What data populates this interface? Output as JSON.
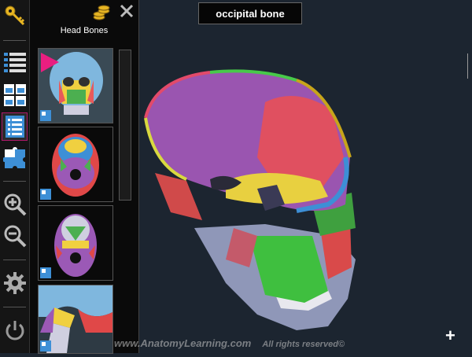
{
  "panel": {
    "title": "Head Bones"
  },
  "viewer": {
    "selected_label": "occipital bone"
  },
  "watermark": {
    "site": "www.AnatomyLearning.com",
    "rights": "All rights reserved©"
  },
  "toolbar": {
    "icons": [
      "key-icon",
      "list-view-icon",
      "grid-view-icon",
      "notes-icon",
      "puzzle-icon",
      "zoom-in-icon",
      "zoom-out-icon",
      "settings-icon",
      "power-icon"
    ]
  },
  "thumbnails": [
    "skull-front-view",
    "skull-top-view",
    "skull-bottom-view",
    "skull-side-view"
  ],
  "colors": {
    "accent": "#c2185b",
    "background": "#1c2530",
    "panel": "#0a0a0a"
  }
}
